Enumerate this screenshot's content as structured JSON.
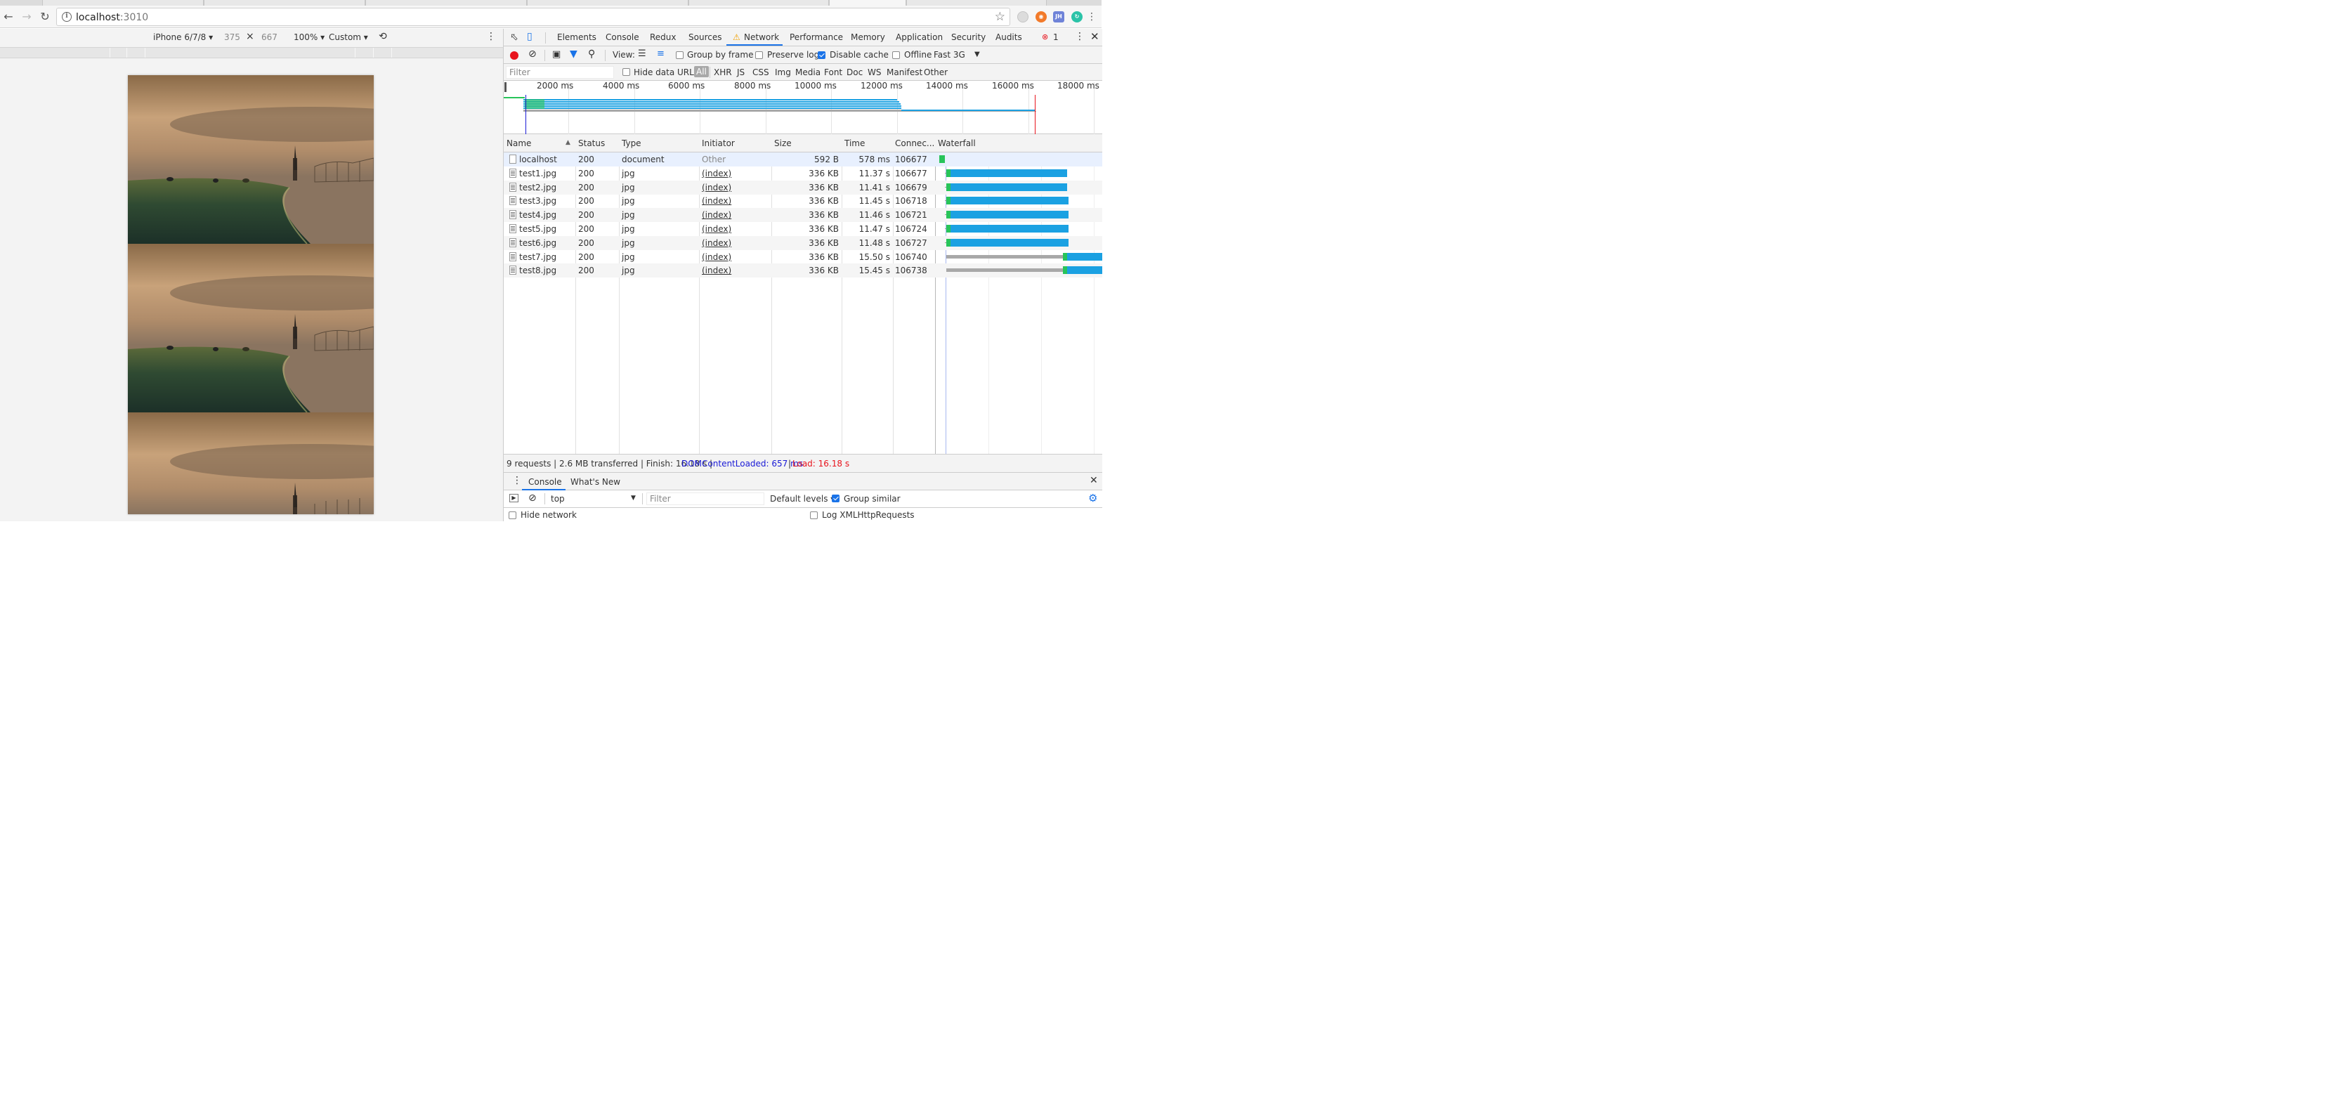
{
  "browser": {
    "url_host": "localhost",
    "url_port": ":3010",
    "extensions": [
      "JH"
    ]
  },
  "device_toolbar": {
    "device": "iPhone 6/7/8",
    "width": "375",
    "times": "×",
    "height": "667",
    "zoom": "100%",
    "throttle": "Custom"
  },
  "devtools": {
    "tabs": [
      "Elements",
      "Console",
      "Redux",
      "Sources",
      "Network",
      "Performance",
      "Memory",
      "Application",
      "Security",
      "Audits"
    ],
    "active_tab": "Network",
    "error_count": "1",
    "toolbar": {
      "view_label": "View:",
      "group_by_frame": "Group by frame",
      "preserve_log": "Preserve log",
      "disable_cache": "Disable cache",
      "offline": "Offline",
      "throttling": "Fast 3G"
    },
    "filter_bar": {
      "placeholder": "Filter",
      "hide_data_urls": "Hide data URLs",
      "types": [
        "All",
        "XHR",
        "JS",
        "CSS",
        "Img",
        "Media",
        "Font",
        "Doc",
        "WS",
        "Manifest",
        "Other"
      ]
    },
    "overview_ticks": [
      "2000 ms",
      "4000 ms",
      "6000 ms",
      "8000 ms",
      "10000 ms",
      "12000 ms",
      "14000 ms",
      "16000 ms",
      "18000 ms"
    ],
    "columns": [
      "Name",
      "Status",
      "Type",
      "Initiator",
      "Size",
      "Time",
      "Connec...",
      "Waterfall"
    ],
    "requests": [
      {
        "name": "localhost",
        "status": "200",
        "type": "document",
        "initiator": "Other",
        "size": "592 B",
        "time": "578 ms",
        "conn": "106677"
      },
      {
        "name": "test1.jpg",
        "status": "200",
        "type": "jpg",
        "initiator": "(index)",
        "size": "336 KB",
        "time": "11.37 s",
        "conn": "106677"
      },
      {
        "name": "test2.jpg",
        "status": "200",
        "type": "jpg",
        "initiator": "(index)",
        "size": "336 KB",
        "time": "11.41 s",
        "conn": "106679"
      },
      {
        "name": "test3.jpg",
        "status": "200",
        "type": "jpg",
        "initiator": "(index)",
        "size": "336 KB",
        "time": "11.45 s",
        "conn": "106718"
      },
      {
        "name": "test4.jpg",
        "status": "200",
        "type": "jpg",
        "initiator": "(index)",
        "size": "336 KB",
        "time": "11.46 s",
        "conn": "106721"
      },
      {
        "name": "test5.jpg",
        "status": "200",
        "type": "jpg",
        "initiator": "(index)",
        "size": "336 KB",
        "time": "11.47 s",
        "conn": "106724"
      },
      {
        "name": "test6.jpg",
        "status": "200",
        "type": "jpg",
        "initiator": "(index)",
        "size": "336 KB",
        "time": "11.48 s",
        "conn": "106727"
      },
      {
        "name": "test7.jpg",
        "status": "200",
        "type": "jpg",
        "initiator": "(index)",
        "size": "336 KB",
        "time": "15.50 s",
        "conn": "106740"
      },
      {
        "name": "test8.jpg",
        "status": "200",
        "type": "jpg",
        "initiator": "(index)",
        "size": "336 KB",
        "time": "15.45 s",
        "conn": "106738"
      }
    ],
    "summary": {
      "main": "9 requests | 2.6 MB transferred | Finish: 16.18 s |",
      "dcl": "DOMContentLoaded: 657 ms",
      "pipe": "|",
      "load": "Load: 16.18 s"
    },
    "drawer": {
      "tabs": [
        "Console",
        "What's New"
      ],
      "context": "top",
      "filter_placeholder": "Filter",
      "levels": "Default levels",
      "group_similar": "Group similar",
      "hide_network": "Hide network",
      "log_xhr": "Log XMLHttpRequests"
    }
  },
  "colors": {
    "accent": "#1a73e8",
    "waterfall_blue": "#1ba1e2",
    "waterfall_green": "#27c45a",
    "waterfall_gray": "#a8a8a8",
    "dcl_blue": "#1a1ad6",
    "load_red": "#e8141d"
  }
}
